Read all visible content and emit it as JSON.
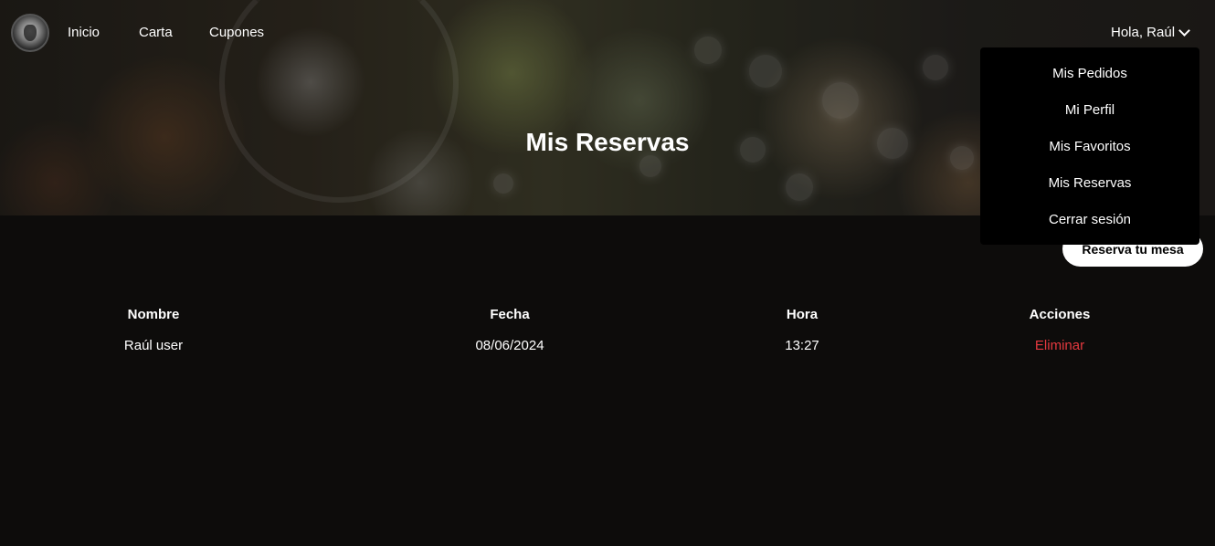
{
  "nav": {
    "links": [
      "Inicio",
      "Carta",
      "Cupones"
    ],
    "user_greeting": "Hola, Raúl"
  },
  "dropdown": {
    "items": [
      "Mis Pedidos",
      "Mi Perfil",
      "Mis Favoritos",
      "Mis Reservas",
      "Cerrar sesión"
    ]
  },
  "hero": {
    "title": "Mis Reservas"
  },
  "reserve_button": "Reserva tu mesa",
  "table": {
    "headers": [
      "Nombre",
      "Fecha",
      "Hora",
      "Acciones"
    ],
    "rows": [
      [
        "Raúl user",
        "08/06/2024",
        "13:27",
        "Eliminar"
      ]
    ]
  },
  "colors": {
    "background": "#0d0c0b",
    "dropdown_bg": "#000000",
    "delete_link": "#e5393f",
    "button_bg": "#ffffff"
  }
}
